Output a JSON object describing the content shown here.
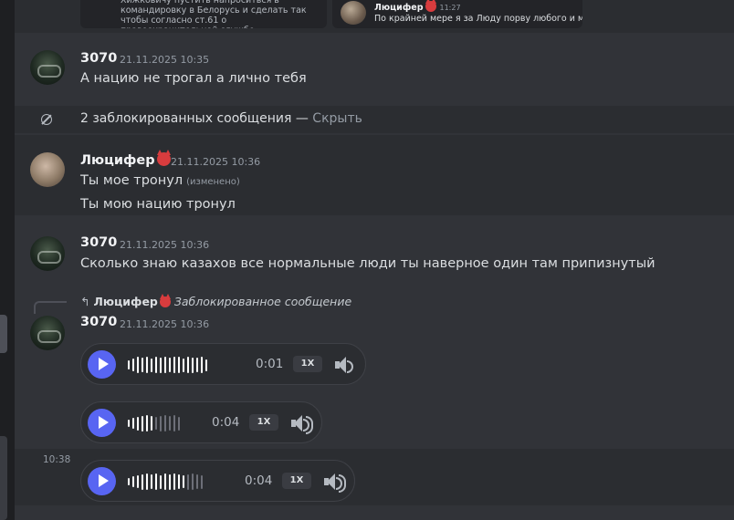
{
  "embeds": {
    "left_text": "Хижковичу пустить напроситься в командировку в Белорусь и сделать так чтобы согласно ст.61 о правоохранительной службе",
    "right_name": "Люцифер",
    "right_time": "11:27",
    "right_text": "По крайней мере я за Люду порву любого и мой"
  },
  "messages": {
    "m1": {
      "user": "3070",
      "time": "21.11.2025 10:35",
      "text": "А нацию не трогал а лично тебя"
    },
    "blocked": {
      "text": "2 заблокированных сообщения — ",
      "link": "Скрыть"
    },
    "m2": {
      "user": "Люцифер",
      "time": "21.11.2025 10:36",
      "line1": "Ты мое тронул",
      "edited": "(изменено)",
      "line2": "Ты мою нацию тронул"
    },
    "m3": {
      "user": "3070",
      "time": "21.11.2025 10:36",
      "text": "Сколько знаю казахов все нормальные люди ты наверное один там припизнутый"
    },
    "m4": {
      "reply_user": "Люцифер",
      "reply_text": "Заблокированное сообщение",
      "user": "3070",
      "time": "21.11.2025 10:36",
      "voice": [
        {
          "duration": "0:01",
          "speed": "1X",
          "progress": 0.0
        },
        {
          "duration": "0:04",
          "speed": "1X",
          "progress": 0.0
        },
        {
          "duration": "0:04",
          "speed": "1X",
          "progress": 0.0
        }
      ],
      "hover_time": "10:38"
    }
  },
  "icons": [
    "play-icon",
    "volume-icon",
    "blocked-icon",
    "reply-arrow-icon",
    "devil-emoji-icon"
  ],
  "colors": {
    "accent": "#5865f2",
    "background": "#313338",
    "text": "#dbdee1",
    "muted": "#949ba4"
  }
}
